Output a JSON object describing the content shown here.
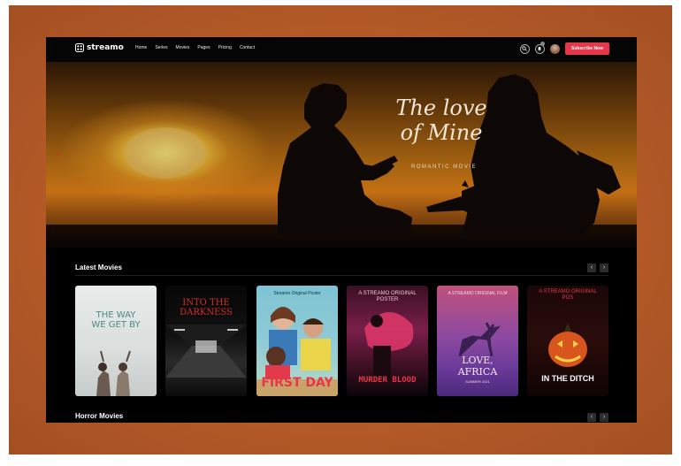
{
  "nav": {
    "logo": "streamo",
    "menu": [
      "Home",
      "Series",
      "Movies",
      "Pages",
      "Pricing",
      "Contact"
    ],
    "subscribe_label": "Subscribe Now"
  },
  "hero": {
    "title_line1": "The love",
    "title_line2": "of Mine",
    "subtitle": "ROMANTIC MOVIE",
    "prev_arrow": "‹"
  },
  "latest": {
    "title": "Latest Movies",
    "posters": [
      {
        "title": "THE WAY WE GET BY",
        "top": "",
        "sub": ""
      },
      {
        "title": "INTO THE DARKNESS",
        "top": "",
        "sub": ""
      },
      {
        "title": "FIRST DAY",
        "top": "Streamo Original Poster",
        "sub": ""
      },
      {
        "title": "MURDER BLOOD",
        "top": "A STREAMO ORIGINAL POSTER",
        "sub": ""
      },
      {
        "title": "LOVE, AFRICA",
        "top": "A STREAMO ORIGINAL FILM",
        "sub": "SUMMER 2021"
      },
      {
        "title": "IN THE DITCH",
        "top": "A STREAMO ORIGINAL POS",
        "sub": ""
      }
    ]
  },
  "horror": {
    "title": "Horror Movies"
  },
  "arrows": {
    "prev": "‹",
    "next": "›"
  },
  "colors": {
    "accent": "#e8364a",
    "background": "#000000",
    "frame": "#b45a28"
  }
}
